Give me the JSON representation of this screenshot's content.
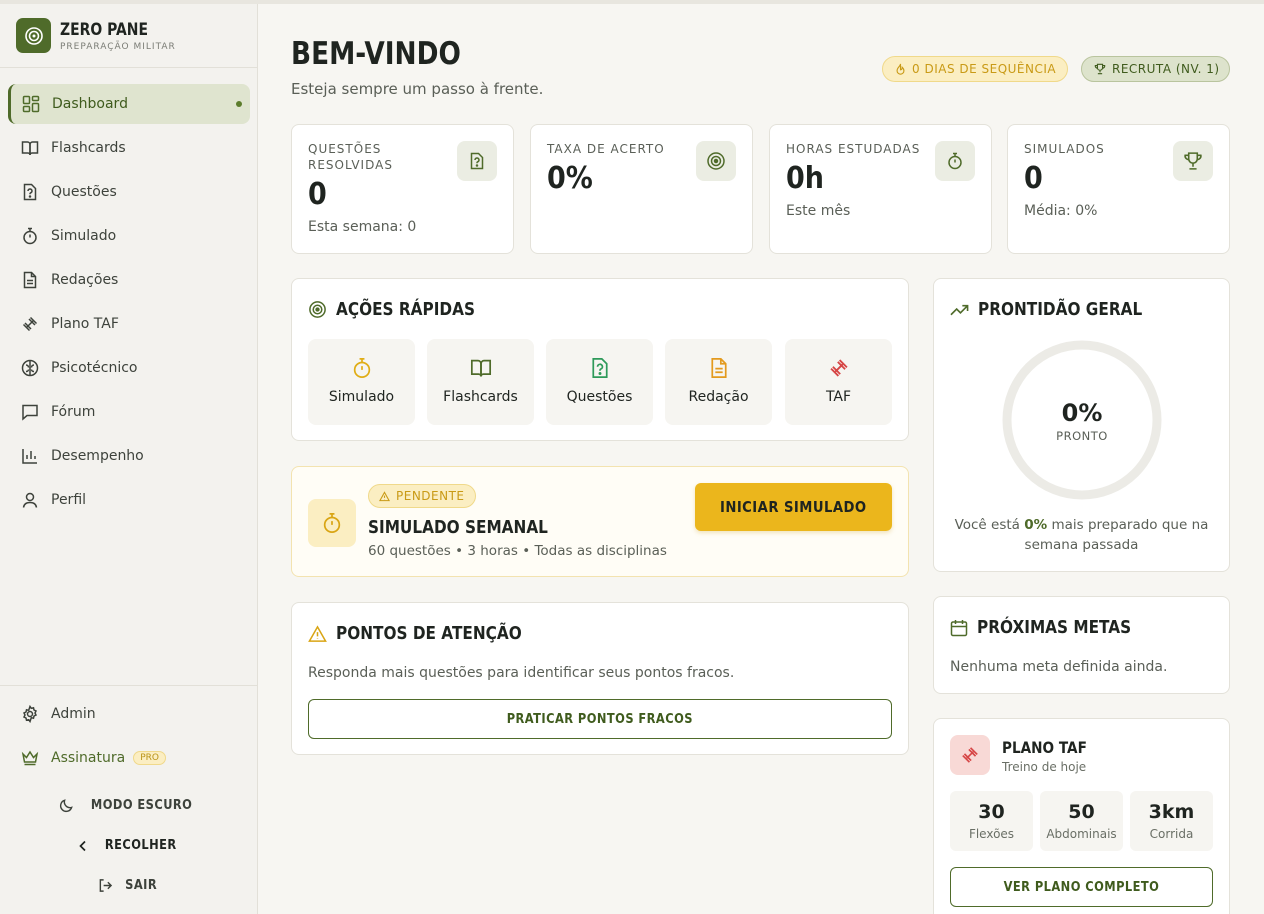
{
  "brand": {
    "name": "ZERO PANE",
    "subtitle": "PREPARAÇÃO MILITAR"
  },
  "sidebar": {
    "items": [
      {
        "label": "Dashboard",
        "icon": "dashboard-icon",
        "active": true
      },
      {
        "label": "Flashcards",
        "icon": "book-icon"
      },
      {
        "label": "Questões",
        "icon": "question-file-icon"
      },
      {
        "label": "Simulado",
        "icon": "stopwatch-icon"
      },
      {
        "label": "Redações",
        "icon": "document-icon"
      },
      {
        "label": "Plano TAF",
        "icon": "dumbbell-icon"
      },
      {
        "label": "Psicotécnico",
        "icon": "brain-icon"
      },
      {
        "label": "Fórum",
        "icon": "chat-icon"
      },
      {
        "label": "Desempenho",
        "icon": "bar-chart-icon"
      },
      {
        "label": "Perfil",
        "icon": "user-icon"
      }
    ],
    "bottom": {
      "admin": "Admin",
      "subscription": "Assinatura",
      "pro_badge": "PRO",
      "dark_mode": "MODO ESCURO",
      "collapse": "RECOLHER",
      "logout": "SAIR"
    }
  },
  "header": {
    "title": "BEM-VINDO",
    "subtitle": "Esteja sempre um passo à frente.",
    "streak": "0 DIAS DE SEQUÊNCIA",
    "rank": "RECRUTA (NV. 1)"
  },
  "stats": [
    {
      "label": "QUESTÕES RESOLVIDAS",
      "value": "0",
      "sub": "Esta semana: 0",
      "icon": "question-file-icon"
    },
    {
      "label": "TAXA DE ACERTO",
      "value": "0%",
      "sub": "",
      "icon": "target-icon"
    },
    {
      "label": "HORAS ESTUDADAS",
      "value": "0h",
      "sub": "Este mês",
      "icon": "stopwatch-icon"
    },
    {
      "label": "SIMULADOS",
      "value": "0",
      "sub": "Média: 0%",
      "icon": "trophy-icon"
    }
  ],
  "quick_actions": {
    "title": "AÇÕES RÁPIDAS",
    "items": [
      {
        "label": "Simulado",
        "icon": "stopwatch-icon"
      },
      {
        "label": "Flashcards",
        "icon": "book-icon"
      },
      {
        "label": "Questões",
        "icon": "question-file-icon"
      },
      {
        "label": "Redação",
        "icon": "document-icon"
      },
      {
        "label": "TAF",
        "icon": "dumbbell-icon"
      }
    ]
  },
  "weekly_exam": {
    "badge": "PENDENTE",
    "title": "SIMULADO SEMANAL",
    "details": "60 questões • 3 horas • Todas as disciplinas",
    "button": "INICIAR SIMULADO"
  },
  "attention": {
    "title": "PONTOS DE ATENÇÃO",
    "text": "Responda mais questões para identificar seus pontos fracos.",
    "button": "PRATICAR PONTOS FRACOS"
  },
  "readiness": {
    "title": "PRONTIDÃO GERAL",
    "value": "0%",
    "value_fraction": 0,
    "label": "PRONTO",
    "note_prefix": "Você está ",
    "note_value": "0%",
    "note_suffix": " mais preparado que na semana passada"
  },
  "goals": {
    "title": "PRÓXIMAS METAS",
    "text": "Nenhuma meta definida ainda."
  },
  "taf": {
    "title": "PLANO TAF",
    "subtitle": "Treino de hoje",
    "stats": [
      {
        "value": "30",
        "label": "Flexões"
      },
      {
        "value": "50",
        "label": "Abdominais"
      },
      {
        "value": "3km",
        "label": "Corrida"
      }
    ],
    "button": "VER PLANO COMPLETO"
  },
  "colors": {
    "brand_green": "#4f6b2a",
    "accent_yellow": "#ebb61c",
    "taf_red": "#d64545",
    "background": "#f7f6f2"
  }
}
